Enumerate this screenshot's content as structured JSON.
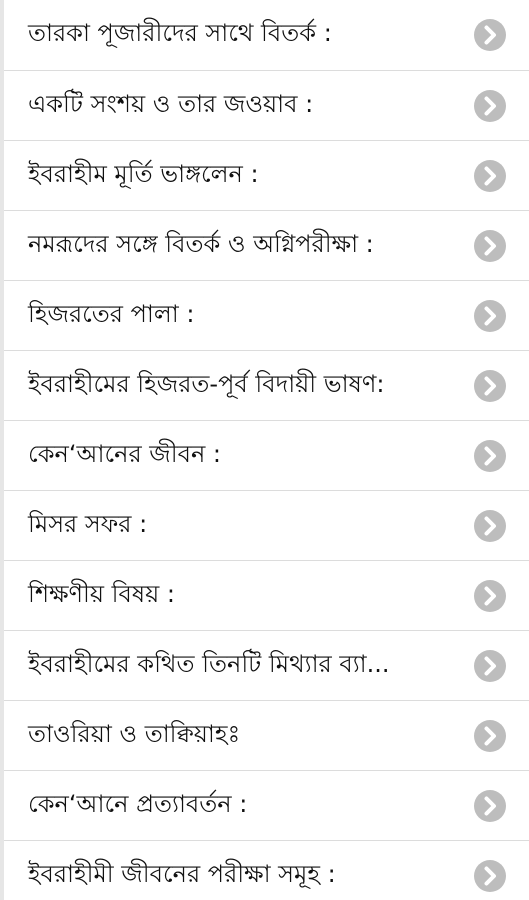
{
  "list": {
    "items": [
      {
        "label": "তারকা পূজারীদের সাথে বিতর্ক :"
      },
      {
        "label": "একটি সংশয় ও তার জওয়াব :"
      },
      {
        "label": "ইবরাহীম মূর্তি ভাঙ্গলেন :"
      },
      {
        "label": "নমরূদের সঙ্গে বিতর্ক ও অগ্নিপরীক্ষা :"
      },
      {
        "label": "হিজরতের পালা :"
      },
      {
        "label": "ইবরাহীমের হিজরত-পূর্ব বিদায়ী ভাষণ:"
      },
      {
        "label": "কেন‘আনের জীবন :"
      },
      {
        "label": "মিসর সফর :"
      },
      {
        "label": "শিক্ষণীয় বিষয় :"
      },
      {
        "label": "ইবরাহীমের কথিত তিনটি মিথ্যার ব্যা..."
      },
      {
        "label": "তাওরিয়া ও তাক্বিয়াহঃ"
      },
      {
        "label": "কেন‘আনে প্রত্যাবর্তন :"
      },
      {
        "label": "ইবরাহীমী জীবনের পরীক্ষা সমূহ :"
      }
    ],
    "chevron_icon": "chevron-right-circle-icon",
    "chevron_color": "#bdbdbd",
    "divider_color": "#dcdcdc"
  }
}
